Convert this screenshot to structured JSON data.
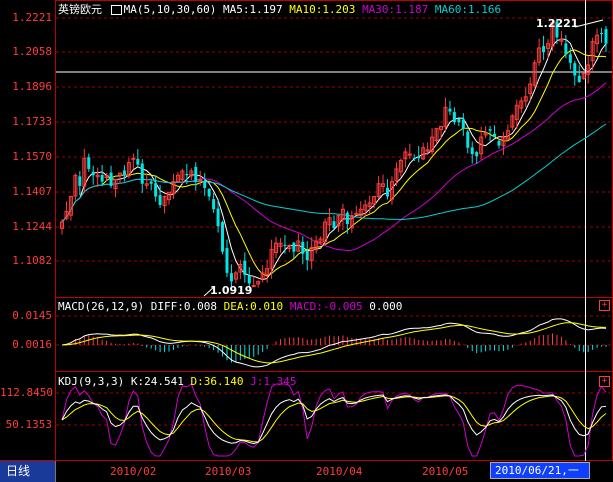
{
  "instrument": "英镑欧元",
  "colors": {
    "up": "#ff3c3c",
    "down": "#00e5e5",
    "ma5": "#ffffff",
    "ma10": "#ffff00",
    "ma30": "#d000d0",
    "ma60": "#00d0d0",
    "grid": "#a00000",
    "frame": "#c00000"
  },
  "ma_header": {
    "label": "MA(5,10,30,60)",
    "ma5": "MA5:1.197",
    "ma10": "MA10:1.203",
    "ma30": "MA30:1.187",
    "ma60": "MA60:1.166"
  },
  "macd_header": {
    "label": "MACD(26,12,9)",
    "diff": "DIFF:0.008",
    "dea": "DEA:0.010",
    "macd": "MACD:-0.005",
    "extra": "0.000"
  },
  "kdj_header": {
    "label": "KDJ(9,3,3)",
    "k": "K:24.541",
    "d": "D:36.140",
    "j": "J:1.345"
  },
  "price_axis": [
    "1.2221",
    "1.2058",
    "1.1896",
    "1.1733",
    "1.1570",
    "1.1407",
    "1.1244",
    "1.1082"
  ],
  "macd_axis": [
    "0.0145",
    "0.0016"
  ],
  "kdj_axis": [
    "112.8450",
    "50.1353"
  ],
  "x_axis": [
    "2010/02",
    "2010/03",
    "2010/04",
    "2010/05"
  ],
  "high_label": "1.2221",
  "low_label": "1.0919",
  "plus_icon_text": "+",
  "bottom_bar": {
    "tab_label": "日线",
    "cursor_date": "2010/06/21,一"
  },
  "chart_data": {
    "type": "candlestick",
    "y_range": [
      1.095,
      1.226
    ],
    "ma_periods": [
      5,
      10,
      30,
      60
    ],
    "closes": [
      1.128,
      1.133,
      1.14,
      1.15,
      1.145,
      1.158,
      1.153,
      1.15,
      1.15,
      1.147,
      1.15,
      1.145,
      1.148,
      1.151,
      1.15,
      1.156,
      1.158,
      1.155,
      1.146,
      1.146,
      1.146,
      1.14,
      1.136,
      1.14,
      1.142,
      1.147,
      1.15,
      1.152,
      1.15,
      1.152,
      1.147,
      1.148,
      1.144,
      1.14,
      1.134,
      1.126,
      1.114,
      1.104,
      1.1,
      1.104,
      1.108,
      1.103,
      1.099,
      1.098,
      1.1,
      1.104,
      1.106,
      1.115,
      1.118,
      1.118,
      1.117,
      1.117,
      1.114,
      1.119,
      1.113,
      1.11,
      1.116,
      1.119,
      1.12,
      1.128,
      1.13,
      1.125,
      1.131,
      1.134,
      1.127,
      1.131,
      1.132,
      1.134,
      1.136,
      1.137,
      1.14,
      1.146,
      1.146,
      1.14,
      1.147,
      1.153,
      1.157,
      1.161,
      1.16,
      1.158,
      1.158,
      1.163,
      1.162,
      1.168,
      1.172,
      1.173,
      1.182,
      1.18,
      1.175,
      1.175,
      1.172,
      1.163,
      1.16,
      1.159,
      1.168,
      1.17,
      1.171,
      1.168,
      1.164,
      1.168,
      1.171,
      1.178,
      1.183,
      1.185,
      1.187,
      1.193,
      1.203,
      1.21,
      1.208,
      1.212,
      1.222,
      1.215,
      1.214,
      1.207,
      1.203,
      1.197,
      1.194,
      1.198,
      1.202,
      1.213,
      1.216,
      1.217,
      1.212
    ]
  }
}
